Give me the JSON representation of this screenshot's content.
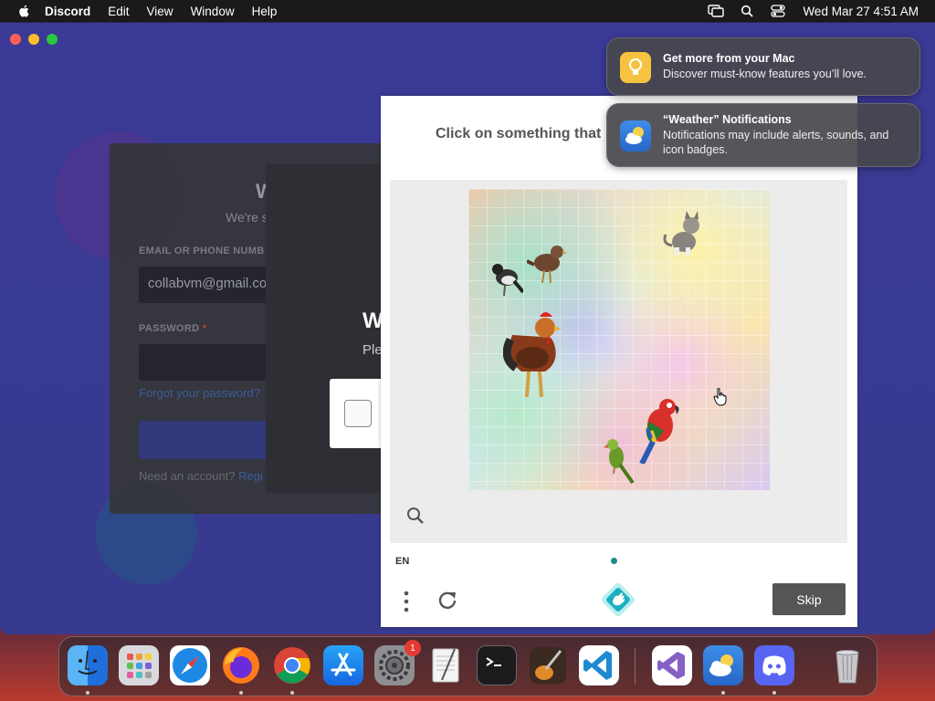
{
  "menubar": {
    "app_name": "Discord",
    "menus": [
      "Edit",
      "View",
      "Window",
      "Help"
    ],
    "clock": "Wed Mar 27  4:51 AM"
  },
  "discord": {
    "login": {
      "heading_partial": "W",
      "subtitle_partial": "We're s",
      "email_label": "EMAIL OR PHONE NUMB",
      "email_value": "collabvm@gmail.co",
      "password_label": "PASSWORD",
      "password_required": "*",
      "forgot_link": "Forgot your password?",
      "need_account": "Need an account?",
      "register_link": "Regi"
    },
    "overlay": {
      "heading_partial": "W",
      "text_partial": "Ple"
    }
  },
  "captcha": {
    "prompt": "Click on something that",
    "language": "EN",
    "skip_label": "Skip",
    "icons": {
      "zoom": "zoom-icon",
      "menu": "more-options-icon",
      "refresh": "refresh-icon",
      "logo": "hcaptcha-logo-icon"
    }
  },
  "notifications": [
    {
      "title": "Get more from your Mac",
      "body": "Discover must-know features you’ll love.",
      "icon": "tips-icon"
    },
    {
      "title": "“Weather” Notifications",
      "body": "Notifications may include alerts, sounds, and icon badges.",
      "icon": "weather-icon"
    }
  ],
  "dock": {
    "apps": [
      "Finder",
      "Launchpad",
      "Safari",
      "Firefox",
      "Chrome",
      "App Store",
      "System Settings",
      "TextEdit",
      "Terminal",
      "GarageBand",
      "Visual Studio Code",
      "Visual Studio",
      "Weather",
      "Discord",
      "Trash"
    ],
    "settings_badge": "1"
  },
  "colors": {
    "discord_bg": "#3a3a92",
    "captcha_accent": "#1a8a8a",
    "skip_button": "#555555",
    "badge_red": "#e43a30"
  }
}
